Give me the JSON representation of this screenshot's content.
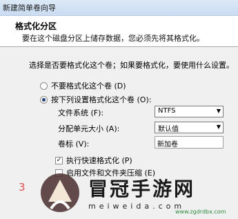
{
  "window": {
    "title": "新建简单卷向导"
  },
  "header": {
    "title": "格式化分区",
    "subtitle": "要在这个磁盘分区上储存数据，您必须先将其格式化。"
  },
  "panel": {
    "question": "选择是否要格式化这个卷；如果要格式化，要使用什么设置。",
    "radio_no_format": "不要格式化这个卷 (D)",
    "radio_format": "按下列设置格式化这个卷 (O):",
    "fs_label": "文件系统 (F):",
    "fs_value": "NTFS",
    "alloc_label": "分配单元大小 (A):",
    "alloc_value": "默认值",
    "volume_label": "卷标 (V):",
    "volume_value": "新加卷",
    "quick_format": "执行快速格式化 (P)",
    "compression": "启用文件和文件夹压缩 (E)"
  },
  "watermark": {
    "number": "3",
    "text": "冒冠手游网",
    "url": "meiweida.com",
    "sub": "www.zgdrdbx.com"
  }
}
